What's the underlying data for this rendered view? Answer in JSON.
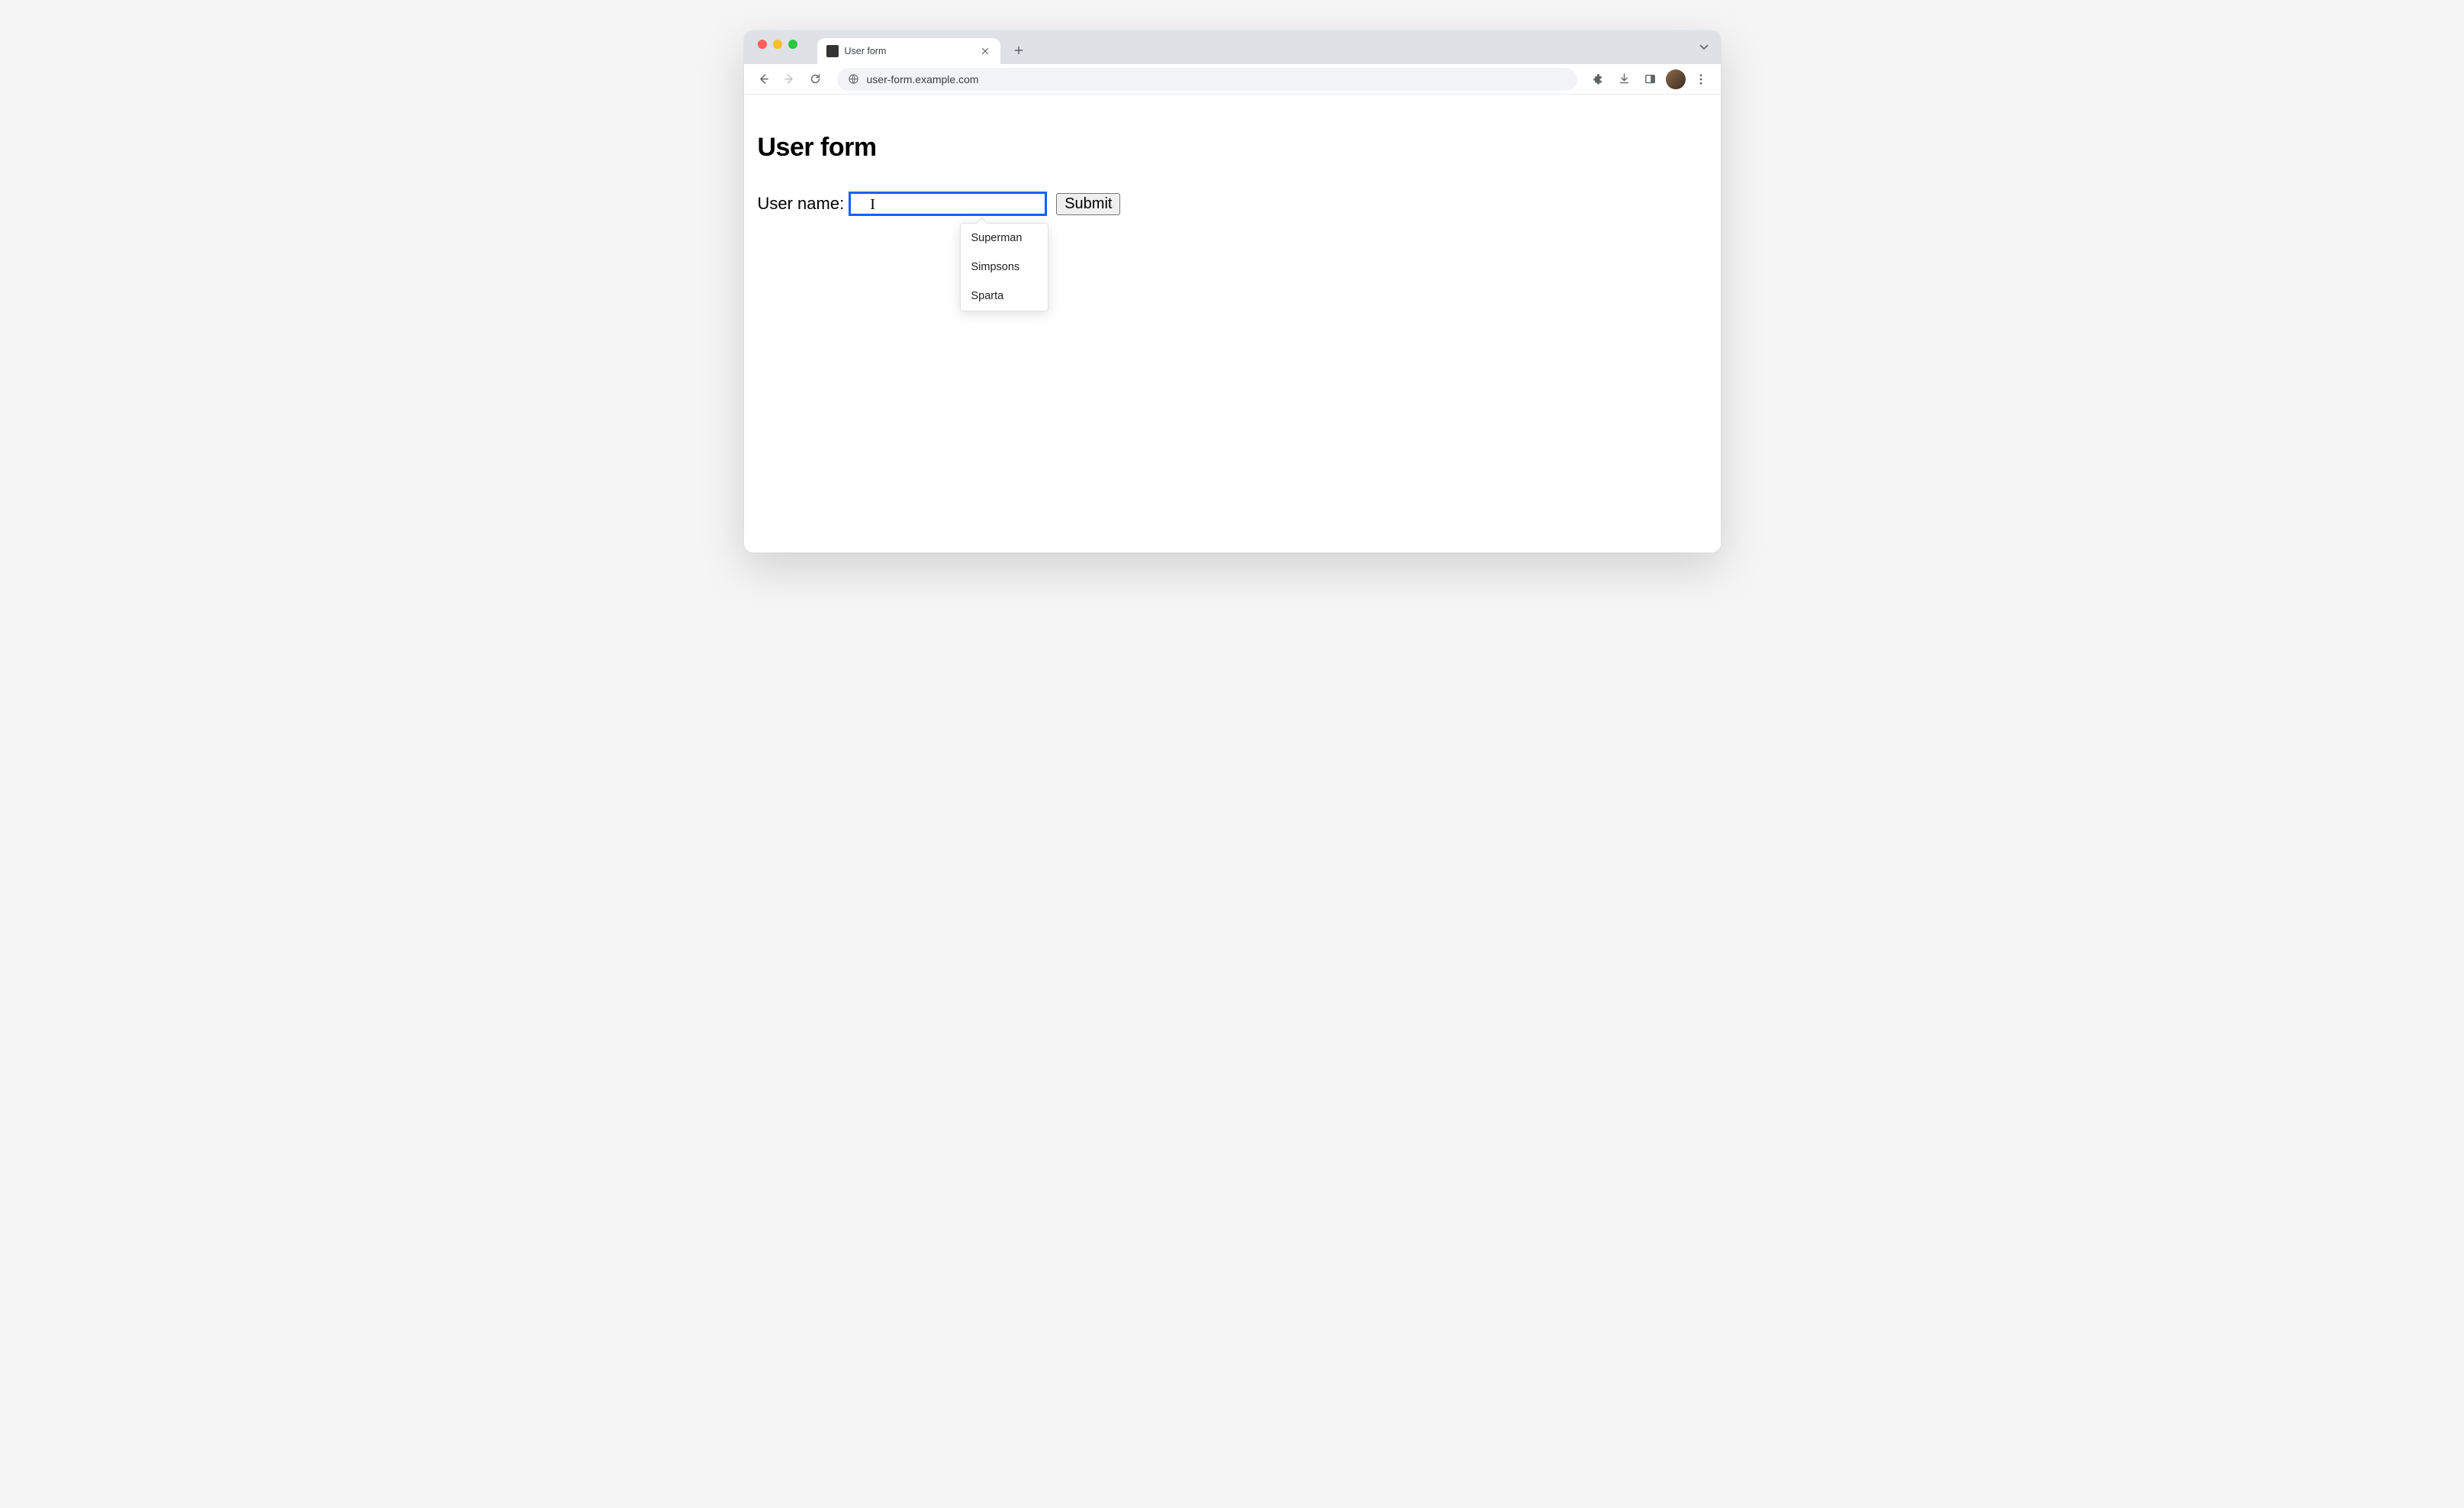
{
  "browser": {
    "tab_title": "User form",
    "url": "user-form.example.com"
  },
  "page": {
    "heading": "User form",
    "form": {
      "label": "User name:",
      "input_value": "",
      "submit_label": "Submit"
    },
    "autocomplete": {
      "options": [
        "Superman",
        "Simpsons",
        "Sparta"
      ]
    }
  }
}
